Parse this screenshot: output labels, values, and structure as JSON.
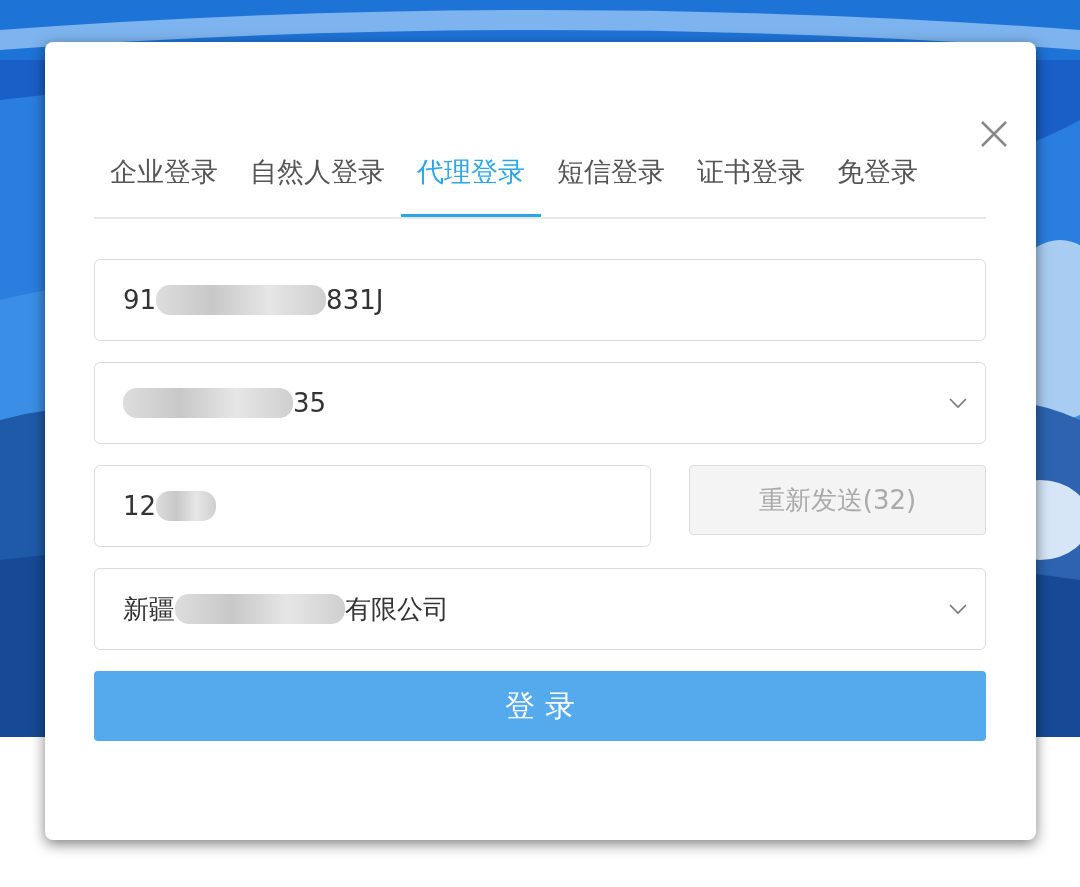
{
  "tabs": [
    {
      "label": "企业登录",
      "selected": false
    },
    {
      "label": "自然人登录",
      "selected": false
    },
    {
      "label": "代理登录",
      "selected": true
    },
    {
      "label": "短信登录",
      "selected": false
    },
    {
      "label": "证书登录",
      "selected": false
    },
    {
      "label": "免登录",
      "selected": false
    }
  ],
  "fields": [
    {
      "kind": "input",
      "value_start": "91",
      "value_end": "831J",
      "redacted": true
    },
    {
      "kind": "select",
      "value_end": "35",
      "redacted": true
    },
    {
      "kind": "code",
      "value_start": "12",
      "redacted": true,
      "button": {
        "label": "重新发送(32)",
        "disabled": true
      }
    },
    {
      "kind": "select",
      "value_start": "新疆",
      "value_end": "有限公司",
      "redacted": true
    }
  ],
  "login_button": "登 录"
}
